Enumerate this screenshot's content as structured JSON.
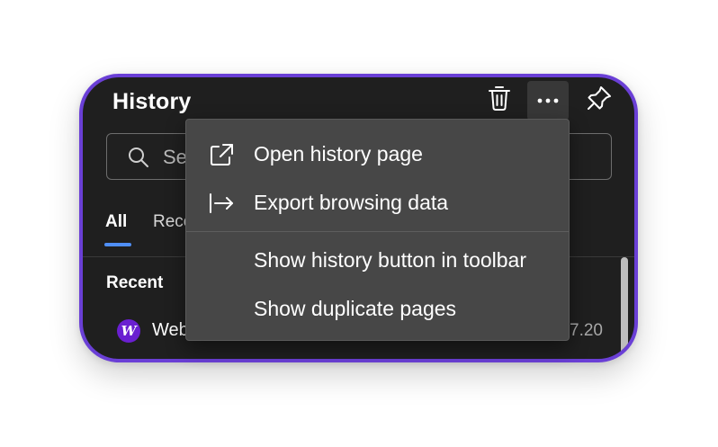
{
  "panel": {
    "title": "History",
    "accent_border_color": "#6a3fd6",
    "toolbar": {
      "delete_icon": "trash-icon",
      "more_icon": "more-options-icon",
      "pin_icon": "pin-icon"
    }
  },
  "search": {
    "placeholder_visible": "Se",
    "icon": "search-icon"
  },
  "tabs": [
    {
      "label": "All",
      "selected": true
    },
    {
      "label": "Rece",
      "selected": false
    }
  ],
  "tab_indicator_color": "#4f8ff7",
  "section": {
    "label": "Recent"
  },
  "history_items": [
    {
      "favicon_letter": "W",
      "title": "Web",
      "time": "7.20"
    }
  ],
  "menu": {
    "items": [
      {
        "label": "Open history page",
        "icon": "open-external-icon"
      },
      {
        "label": "Export browsing data",
        "icon": "export-icon"
      },
      {
        "label": "Show history button in toolbar",
        "icon": ""
      },
      {
        "label": "Show duplicate pages",
        "icon": ""
      }
    ]
  }
}
